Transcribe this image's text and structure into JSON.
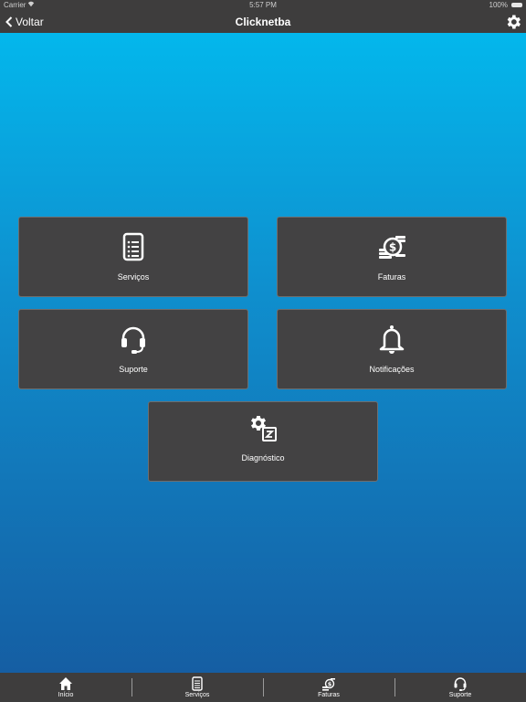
{
  "status_bar": {
    "carrier": "Carrier",
    "time": "5:57 PM",
    "battery": "100%"
  },
  "nav": {
    "back_label": "Voltar",
    "title": "Clicknetba",
    "settings_icon": "gear-icon"
  },
  "tiles": [
    {
      "label": "Serviços",
      "icon": "document-list-icon"
    },
    {
      "label": "Faturas",
      "icon": "coins-icon"
    },
    {
      "label": "Suporte",
      "icon": "headset-icon"
    },
    {
      "label": "Notificações",
      "icon": "bell-icon"
    },
    {
      "label": "Diagnóstico",
      "icon": "gear-diagnostic-icon"
    }
  ],
  "tab_bar": {
    "items": [
      {
        "label": "Início",
        "icon": "home-icon"
      },
      {
        "label": "Serviços",
        "icon": "document-list-icon"
      },
      {
        "label": "Faturas",
        "icon": "coins-icon"
      },
      {
        "label": "Suporte",
        "icon": "headset-icon"
      }
    ]
  },
  "colors": {
    "bar_background": "#3e3d3d",
    "tile_background": "#434243",
    "gradient_top": "#03b7ec",
    "gradient_bottom": "#155ea3"
  }
}
